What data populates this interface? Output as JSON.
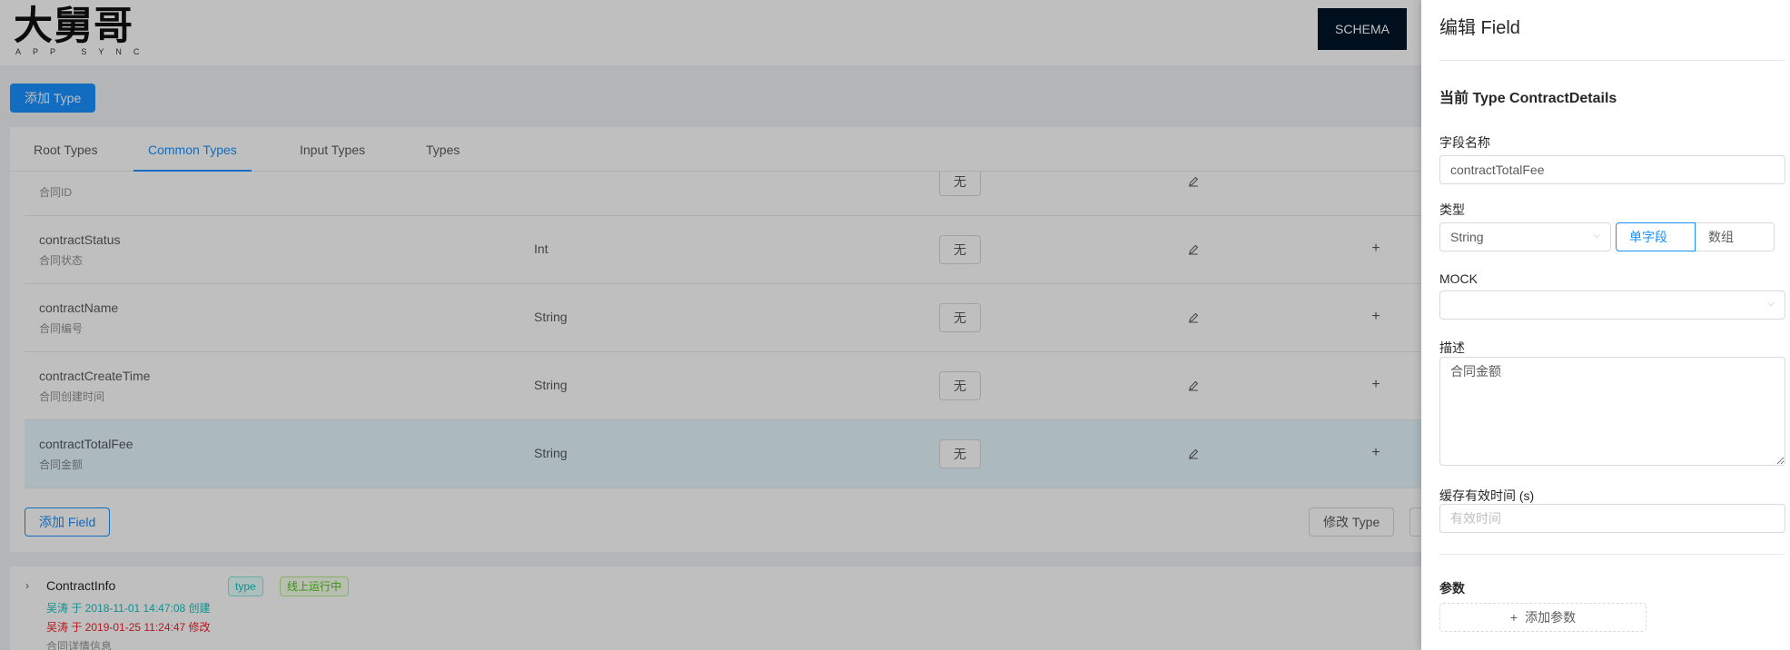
{
  "header": {
    "logo_main": "大舅哥",
    "logo_sub": "APP SYNC",
    "schema_label": "SCHEMA"
  },
  "toolbar": {
    "add_type_label": "添加 Type"
  },
  "tabs": [
    {
      "label": "Root Types",
      "active": false
    },
    {
      "label": "Common Types",
      "active": true
    },
    {
      "label": "Input Types",
      "active": false
    },
    {
      "label": "Types",
      "active": false
    }
  ],
  "fields": [
    {
      "name": "",
      "desc": "合同ID",
      "type": "",
      "mock": "无",
      "selected": false
    },
    {
      "name": "contractStatus",
      "desc": "合同状态",
      "type": "Int",
      "mock": "无",
      "selected": false
    },
    {
      "name": "contractName",
      "desc": "合同编号",
      "type": "String",
      "mock": "无",
      "selected": false
    },
    {
      "name": "contractCreateTime",
      "desc": "合同创建时间",
      "type": "String",
      "mock": "无",
      "selected": false
    },
    {
      "name": "contractTotalFee",
      "desc": "合同金额",
      "type": "String",
      "mock": "无",
      "selected": true
    }
  ],
  "card_actions": {
    "add_field_label": "添加 Field",
    "modify_type_label": "修改 Type"
  },
  "type_item": {
    "name": "ContractInfo",
    "tag_type": "type",
    "tag_status": "线上运行中",
    "created": "吴涛 于 2018-11-01 14:47:08 创建",
    "modified": "吴涛 于 2019-01-25 11:24:47 修改",
    "desc": "合同详情信息"
  },
  "drawer": {
    "title": "编辑 Field",
    "current_type": "当前 Type ContractDetails",
    "field_name_label": "字段名称",
    "field_name_value": "contractTotalFee",
    "type_label": "类型",
    "type_value": "String",
    "single_label": "单字段",
    "array_label": "数组",
    "mock_label": "MOCK",
    "mock_value": "",
    "desc_label": "描述",
    "desc_value": "合同金额",
    "cache_label": "缓存有效时间 (s)",
    "cache_placeholder": "有效时间",
    "params_label": "参数",
    "add_param_label": "添加参数"
  },
  "colors": {
    "primary": "#1890ff",
    "dark_button": "#001529",
    "selected_row": "#e6f7ff",
    "tag_cyan": "#13c2c2",
    "tag_green": "#52c41a",
    "modified_red": "#f5222d"
  }
}
